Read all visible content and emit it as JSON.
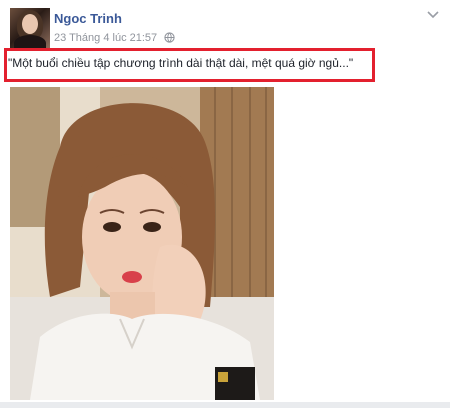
{
  "post": {
    "author_name": "Ngoc Trinh",
    "timestamp": "23 Tháng 4 lúc 21:57",
    "status_text": "\"Một buổi chiều tập chương trình dài thật dài, mệt quá giờ ngủ...\"",
    "highlight_color": "#e3202e",
    "link_color": "#3b5998"
  },
  "icons": {
    "privacy": "globe-icon",
    "menu": "chevron-down-icon"
  }
}
